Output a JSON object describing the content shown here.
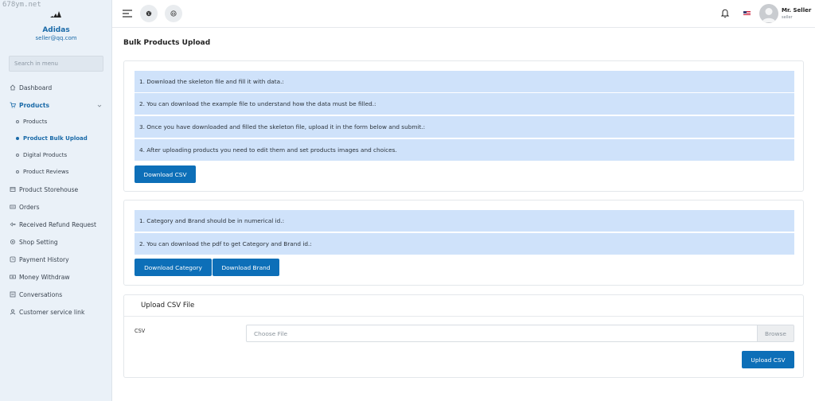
{
  "watermark": "678ym.net",
  "sidebar": {
    "brand_name": "Adidas",
    "brand_email": "seller@qq.com",
    "search_placeholder": "Search in menu",
    "items": {
      "dashboard": "Dashboard",
      "products": "Products",
      "product_storehouse": "Product Storehouse",
      "orders": "Orders",
      "refund": "Received Refund Request",
      "shop_setting": "Shop Setting",
      "payment_history": "Payment History",
      "money_withdraw": "Money Withdraw",
      "conversations": "Conversations",
      "customer_service": "Customer service link"
    },
    "sub_items": {
      "products": "Products",
      "bulk_upload": "Product Bulk Upload",
      "digital_products": "Digital Products",
      "product_reviews": "Product Reviews"
    },
    "active_item": "products",
    "active_sub_item": "bulk_upload"
  },
  "header": {
    "user_name": "Mr. Seller",
    "user_role": "seller"
  },
  "main": {
    "page_title": "Bulk Products Upload",
    "instructions": {
      "line1": "1. Download the skeleton file and fill it with data.:",
      "line2": "2. You can download the example file to understand how the data must be filled.:",
      "line3": "3. Once you have downloaded and filled the skeleton file, upload it in the form below and submit.:",
      "line4": "4. After uploading products you need to edit them and set products images and choices."
    },
    "download_csv_label": "Download CSV",
    "id_notes": {
      "line1": "1. Category and Brand should be in numerical id.:",
      "line2": "2. You can download the pdf to get Category and Brand id.:"
    },
    "download_category_label": "Download Category",
    "download_brand_label": "Download Brand",
    "upload": {
      "title": "Upload CSV File",
      "csv_label": "CSV",
      "file_placeholder": "Choose File",
      "browse_label": "Browse",
      "submit_label": "Upload CSV"
    }
  },
  "colors": {
    "primary": "#0d6fb8",
    "info_bg": "#cfe2fa",
    "sidebar_bg": "#eaf1f8",
    "accent_text": "#1a6aa8"
  }
}
